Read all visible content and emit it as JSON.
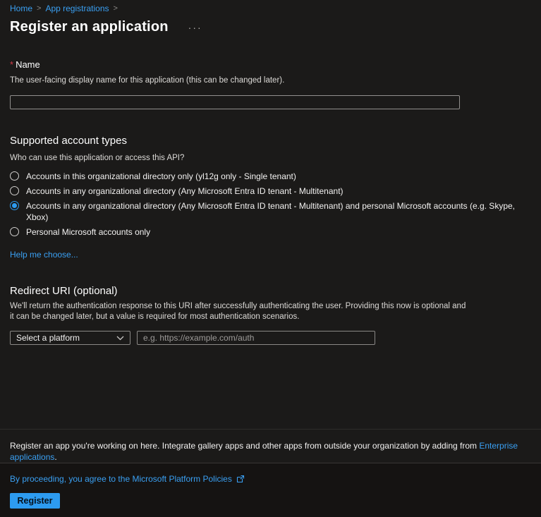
{
  "colors": {
    "page_bg": "#1b1a19",
    "footer_bg": "#151312",
    "link_blue": "#3aa0f3",
    "accent_blue": "#2d9bf0",
    "required_red": "#d13b47",
    "input_border": "#8a8886"
  },
  "breadcrumb": {
    "items": [
      {
        "label": "Home"
      },
      {
        "label": "App registrations"
      }
    ]
  },
  "header": {
    "title": "Register an application",
    "more_options_icon": "···"
  },
  "name_section": {
    "required_marker": "*",
    "label": "Name",
    "description": "The user-facing display name for this application (this can be changed later).",
    "input_value": ""
  },
  "account_types_section": {
    "title": "Supported account types",
    "question": "Who can use this application or access this API?",
    "options": [
      {
        "label": "Accounts in this organizational directory only (yl12g only - Single tenant)",
        "selected": false
      },
      {
        "label": "Accounts in any organizational directory (Any Microsoft Entra ID tenant - Multitenant)",
        "selected": false
      },
      {
        "label": "Accounts in any organizational directory (Any Microsoft Entra ID tenant - Multitenant) and personal Microsoft accounts (e.g. Skype, Xbox)",
        "selected": true
      },
      {
        "label": "Personal Microsoft accounts only",
        "selected": false
      }
    ],
    "help_link": "Help me choose..."
  },
  "redirect_section": {
    "title": "Redirect URI (optional)",
    "description": "We'll return the authentication response to this URI after successfully authenticating the user. Providing this now is optional and it can be changed later, but a value is required for most authentication scenarios.",
    "platform_select_value": "Select a platform",
    "uri_placeholder": "e.g. https://example.com/auth"
  },
  "info": {
    "text_before_link": "Register an app you're working on here. Integrate gallery apps and other apps from outside your organization by adding from ",
    "link": "Enterprise applications",
    "text_after_link": "."
  },
  "footer": {
    "policy_text": "By proceeding, you agree to the Microsoft Platform Policies",
    "register_label": "Register"
  }
}
